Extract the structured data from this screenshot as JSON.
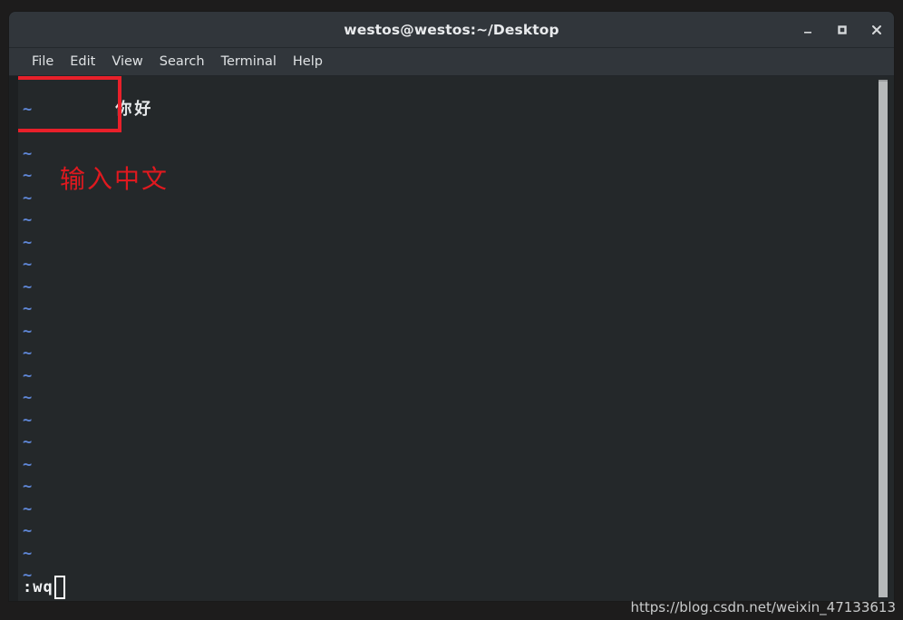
{
  "window": {
    "title": "westos@westos:~/Desktop",
    "controls": [
      {
        "name": "minimize",
        "glyph": "–"
      },
      {
        "name": "maximize",
        "glyph": "□"
      },
      {
        "name": "close",
        "glyph": "×"
      }
    ]
  },
  "menubar": {
    "items": [
      {
        "label": "File"
      },
      {
        "label": "Edit"
      },
      {
        "label": "View"
      },
      {
        "label": "Search"
      },
      {
        "label": "Terminal"
      },
      {
        "label": "Help"
      }
    ]
  },
  "editor": {
    "first_line": "你好",
    "tilde": "~",
    "tilde_count": 22,
    "command_line": ":wq",
    "cursor_shape": "block-outline"
  },
  "annotations": {
    "box_color": "#e8202a",
    "label_text": "输入中文",
    "label_color": "#e0191f"
  },
  "watermark": {
    "text": "https://blog.csdn.net/weixin_47133613"
  },
  "colors": {
    "titlebar_bg": "#31363b",
    "terminal_bg": "#24282a",
    "tilde_blue": "#5f87d7",
    "scrollbar_thumb": "#b6b9ba",
    "text_white": "#e6e8ea"
  }
}
